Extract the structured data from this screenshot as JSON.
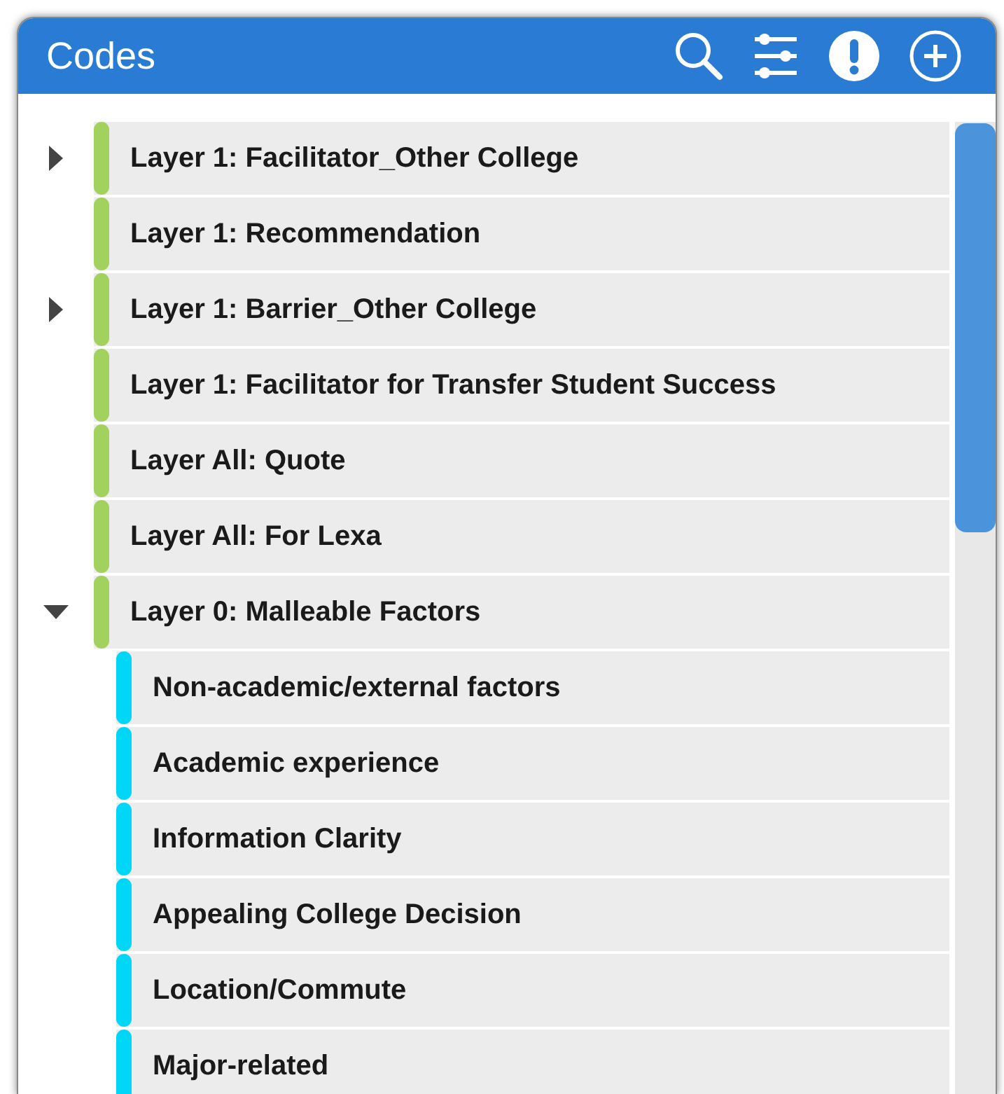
{
  "panel": {
    "title": "Codes"
  },
  "codes": [
    {
      "label": "Layer 1: Facilitator_Other College",
      "color": "#a3d15e",
      "expanded": false
    },
    {
      "label": "Layer 1: Recommendation",
      "color": "#a3d15e"
    },
    {
      "label": "Layer 1: Barrier_Other College",
      "color": "#a3d15e",
      "expanded": false
    },
    {
      "label": "Layer 1: Facilitator for Transfer Student Success",
      "color": "#a3d15e"
    },
    {
      "label": "Layer All: Quote",
      "color": "#a3d15e"
    },
    {
      "label": "Layer All: For Lexa",
      "color": "#a3d15e"
    },
    {
      "label": "Layer 0: Malleable Factors",
      "color": "#a3d15e",
      "expanded": true,
      "children": [
        {
          "label": "Non-academic/external factors",
          "color": "#00d7f7"
        },
        {
          "label": "Academic experience",
          "color": "#00d7f7"
        },
        {
          "label": "Information Clarity",
          "color": "#00d7f7"
        },
        {
          "label": "Appealing College Decision",
          "color": "#00d7f7"
        },
        {
          "label": "Location/Commute",
          "color": "#00d7f7"
        },
        {
          "label": "Major-related",
          "color": "#00d7f7"
        }
      ]
    }
  ]
}
